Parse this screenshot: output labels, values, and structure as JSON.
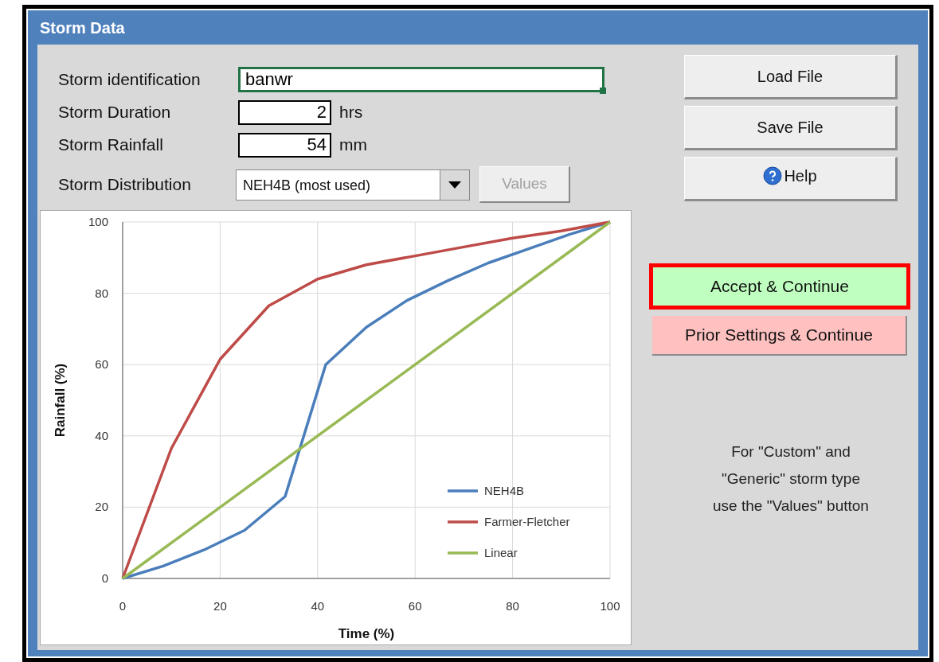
{
  "window": {
    "title": "Storm Data"
  },
  "fields": [
    {
      "label": "Storm identification",
      "value": "banwr",
      "kind": "text",
      "focused": true
    },
    {
      "label": "Storm Duration",
      "value": "2",
      "unit": "hrs",
      "kind": "number",
      "focused": false
    },
    {
      "label": "Storm Rainfall",
      "value": "54",
      "unit": "mm",
      "kind": "number",
      "focused": false
    },
    {
      "label": "Storm Distribution",
      "value": "NEH4B (most used)",
      "kind": "dropdown",
      "focused": false,
      "button": {
        "label": "Values",
        "disabled": true
      }
    }
  ],
  "file_buttons": [
    {
      "label": "Load File",
      "kind": "plain"
    },
    {
      "label": "Save File",
      "kind": "plain"
    },
    {
      "label": "Help",
      "kind": "help"
    }
  ],
  "action_buttons": [
    {
      "label": "Accept & Continue",
      "kind": "accept",
      "highlighted": true
    },
    {
      "label": "Prior Settings & Continue",
      "kind": "prior",
      "highlighted": false
    }
  ],
  "note": [
    "For \"Custom\" and",
    "\"Generic\" storm type",
    "use the \"Values\" button"
  ],
  "chart": {
    "chart_data": {
      "type": "line",
      "grid": true,
      "legend": true,
      "xlabel": "Time (%)",
      "ylabel": "Rainfall (%)",
      "xlim": [
        0,
        100
      ],
      "ylim": [
        0,
        100
      ],
      "xticks": [
        0,
        20,
        40,
        60,
        80,
        100
      ],
      "yticks": [
        0,
        20,
        40,
        60,
        80,
        100
      ],
      "series": [
        {
          "name": "NEH4B",
          "color": "#4a7ebb",
          "x": [
            0,
            8.33,
            16.67,
            25,
            33.33,
            41.67,
            50,
            58.33,
            66.67,
            75,
            83.33,
            91.67,
            100
          ],
          "values": [
            0,
            3.5,
            8,
            13.5,
            23,
            60,
            70.5,
            78,
            83.5,
            88.5,
            92.5,
            96.5,
            100
          ]
        },
        {
          "name": "Farmer-Fletcher",
          "color": "#be4b48",
          "x": [
            0,
            10,
            20,
            30,
            40,
            50,
            60,
            70,
            80,
            90,
            100
          ],
          "values": [
            0,
            36.5,
            61.5,
            76.5,
            84,
            88,
            90.5,
            93,
            95.5,
            97.5,
            100
          ]
        },
        {
          "name": "Linear",
          "color": "#98b954",
          "x": [
            0,
            100
          ],
          "values": [
            0,
            100
          ]
        }
      ]
    }
  }
}
